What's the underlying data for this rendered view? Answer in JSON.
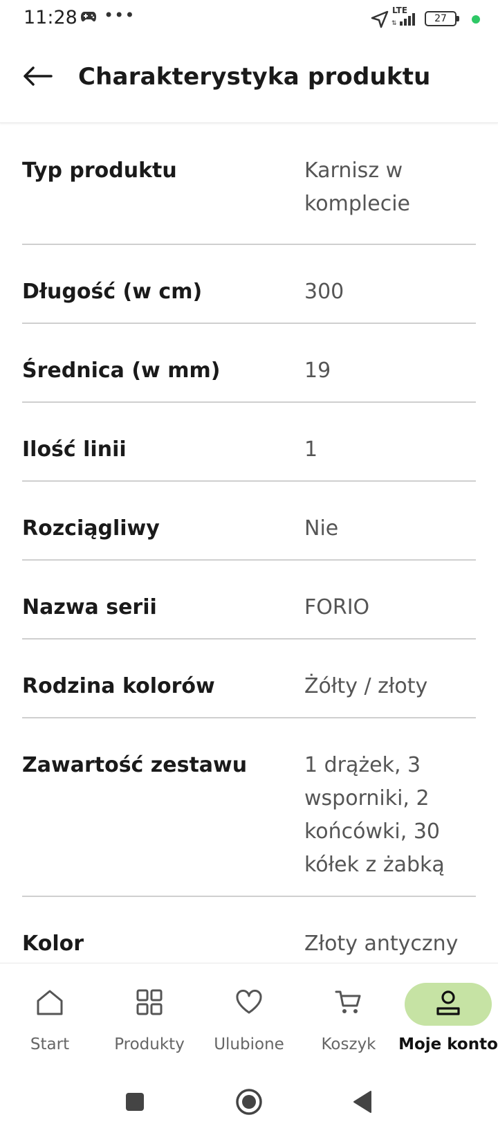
{
  "status_bar": {
    "time": "11:28",
    "dots": "•••",
    "network": "LTE",
    "battery": "27",
    "dot_color": "#2ec866"
  },
  "header": {
    "title": "Charakterystyka produktu",
    "back_icon": "arrow-left-icon"
  },
  "specs": [
    {
      "name": "Typ produktu",
      "value": "Karnisz w komplecie"
    },
    {
      "name": "Długość (w cm)",
      "value": "300"
    },
    {
      "name": "Średnica (w mm)",
      "value": "19"
    },
    {
      "name": "Ilość linii",
      "value": "1"
    },
    {
      "name": "Rozciągliwy",
      "value": "Nie"
    },
    {
      "name": "Nazwa serii",
      "value": "FORIO"
    },
    {
      "name": "Rodzina kolorów",
      "value": "Żółty / złoty"
    },
    {
      "name": "Zawartość zestawu",
      "value": "1 drążek, 3 wsporniki, 2 końcówki, 30 kółek z żabką"
    },
    {
      "name": "Kolor",
      "value": "Złoty antyczny"
    }
  ],
  "bottom_nav": {
    "active_color": "#c6e3a4",
    "items": [
      {
        "label": "Start",
        "icon": "home-icon"
      },
      {
        "label": "Produkty",
        "icon": "grid-icon"
      },
      {
        "label": "Ulubione",
        "icon": "heart-icon"
      },
      {
        "label": "Koszyk",
        "icon": "cart-icon"
      },
      {
        "label": "Moje konto",
        "icon": "user-icon",
        "active": true
      }
    ]
  },
  "system_nav": {
    "buttons": [
      "square-icon",
      "circle-icon",
      "back-triangle-icon"
    ]
  }
}
